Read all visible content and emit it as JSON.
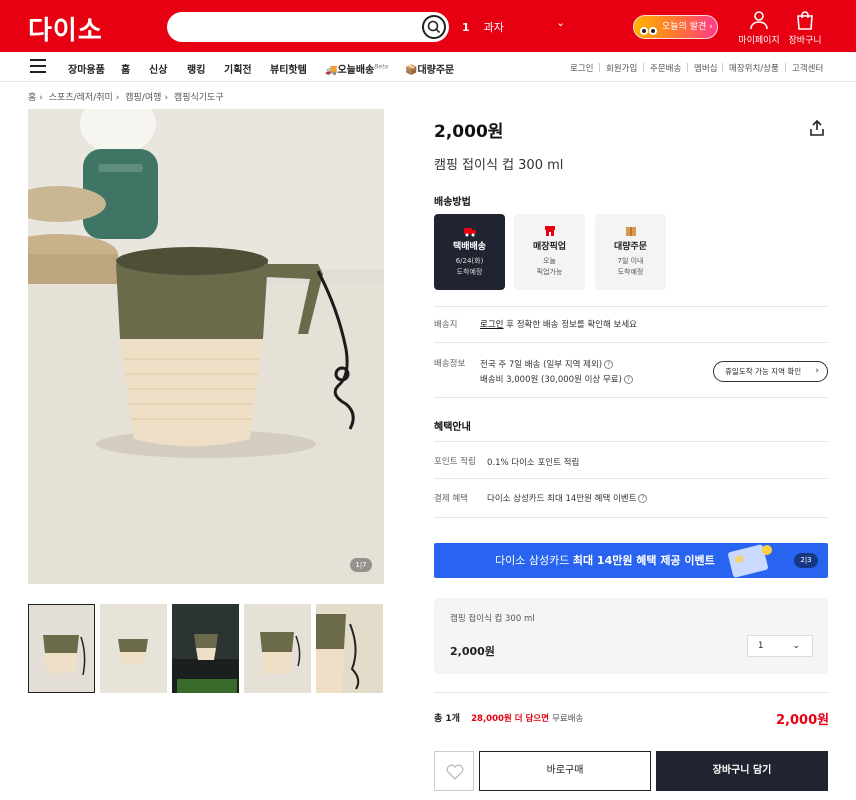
{
  "header": {
    "logo": "다이소",
    "search_placeholder": "",
    "rank": {
      "num": "1",
      "term": "과자"
    },
    "promo_label": "오늘의 발견",
    "mypage_label": "마이페이지",
    "cart_label": "장바구니"
  },
  "nav": {
    "items": [
      "장마용품",
      "홈",
      "신상",
      "랭킹",
      "기획전",
      "뷰티핫템",
      "오늘배송",
      "대량주문"
    ],
    "beta": "Beta",
    "util": [
      "로그인",
      "회원가입",
      "주문배송",
      "멤버십",
      "매장위치/상품",
      "고객센터"
    ]
  },
  "breadcrumb": [
    "홈",
    "스포츠/레저/취미",
    "캠핑/여행",
    "캠핑식기도구"
  ],
  "gallery": {
    "counter": "1|7"
  },
  "product": {
    "price": "2,000원",
    "name": "캠핑 접이식 컵 300 ml"
  },
  "shipping": {
    "title": "배송방법",
    "options": [
      {
        "title": "택배배송",
        "line1": "6/24(화)",
        "line2": "도착예정"
      },
      {
        "title": "매장픽업",
        "line1": "오늘",
        "line2": "픽업가능"
      },
      {
        "title": "대량주문",
        "line1": "7일 이내",
        "line2": "도착예정"
      }
    ],
    "dest_label": "배송지",
    "dest_login": "로그인",
    "dest_text": "후 정확한 배송 정보를 확인해 보세요",
    "info_label": "배송정보",
    "info_line1": "전국 주 7일 배송 (일부 지역 제외)",
    "info_line2": "배송비 3,000원 (30,000원 이상 무료)",
    "holiday_button": "휴일도착 가능 지역 확인"
  },
  "benefit": {
    "title": "혜택안내",
    "point_label": "포인트 적립",
    "point_text": "0.1% 다이소 포인트 적립",
    "pay_label": "결제 혜택",
    "pay_text": "다이소 삼성카드 최대 14만원 혜택 이벤트"
  },
  "banner": {
    "prefix": "다이소 삼성카드 ",
    "bold": "최대 14만원 혜택 제공 이벤트",
    "page": "2|3"
  },
  "option": {
    "name": "캠핑 접이식 컵 300 ml",
    "price": "2,000원",
    "qty": "1"
  },
  "total": {
    "count": "총 1개",
    "free_msg": "28,000원 더 담으면",
    "free_suffix": "무료배송",
    "price": "2,000원"
  },
  "buttons": {
    "buy": "바로구매",
    "cart": "장바구니 담기"
  },
  "colors": {
    "brand": "#e60012",
    "dark": "#1f2430",
    "banner": "#2864f0"
  }
}
